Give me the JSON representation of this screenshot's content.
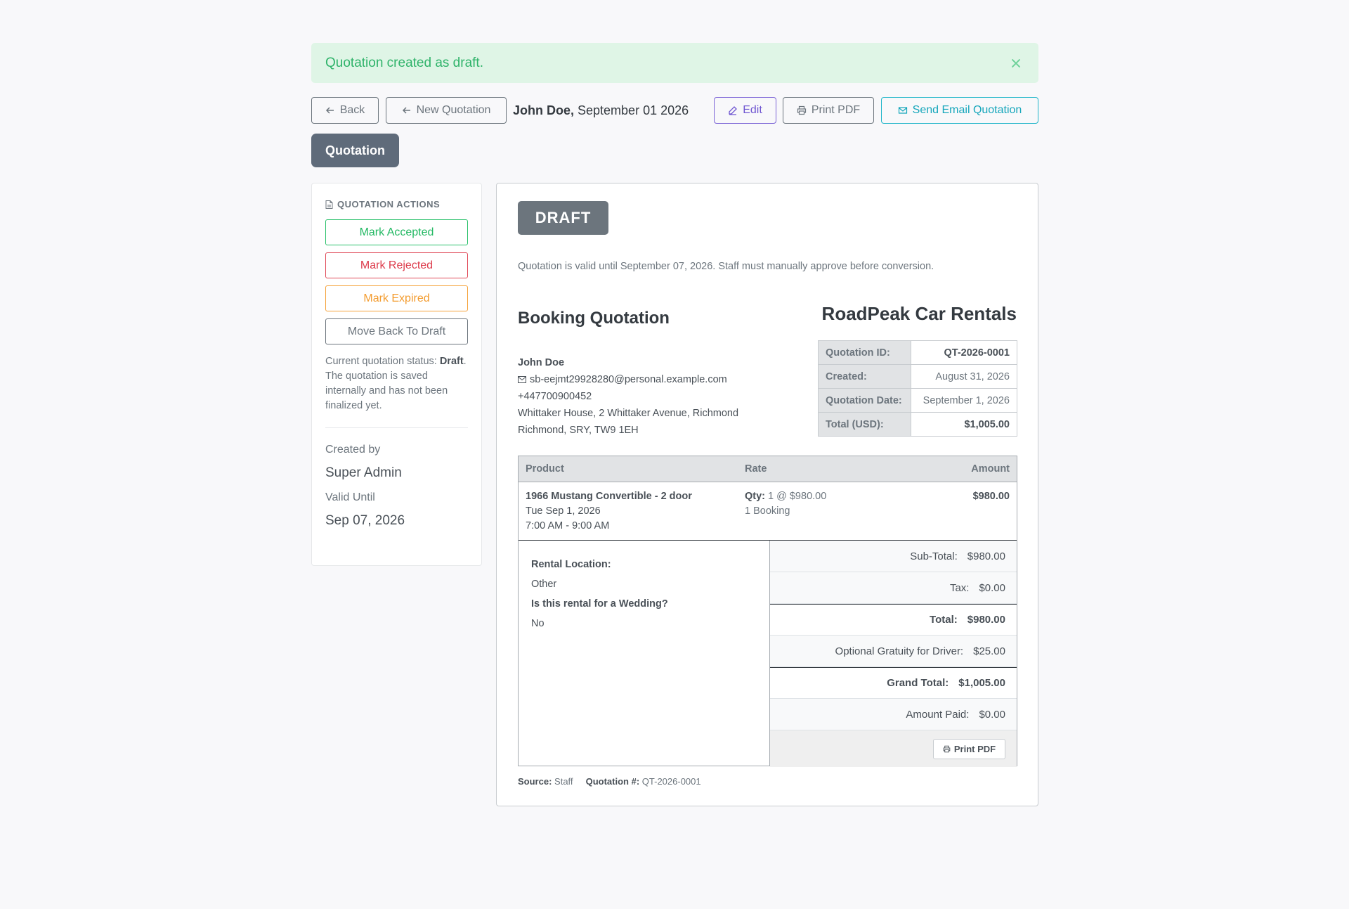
{
  "alert": {
    "message": "Quotation created as draft."
  },
  "toolbar": {
    "back_label": "Back",
    "new_label": "New Quotation",
    "customer_name": "John Doe,",
    "date": "September 01 2026",
    "edit_label": "Edit",
    "print_label": "Print PDF",
    "email_label": "Send Email Quotation"
  },
  "tab": {
    "label": "Quotation"
  },
  "sidebar": {
    "heading": "QUOTATION ACTIONS",
    "actions": [
      "Mark Accepted",
      "Mark Rejected",
      "Mark Expired",
      "Move Back To Draft"
    ],
    "status_prefix": "Current quotation status:",
    "status_value": "Draft",
    "status_suffix": ". The quotation is saved internally and has not been finalized yet.",
    "created_by_label": "Created by",
    "created_by_value": "Super Admin",
    "valid_until_label": "Valid Until",
    "valid_until_value": "Sep 07, 2026"
  },
  "quote": {
    "status_badge": "DRAFT",
    "validity_note": "Quotation is valid until September 07, 2026. Staff must manually approve before conversion.",
    "title": "Booking Quotation",
    "company": "RoadPeak Car Rentals",
    "info": {
      "id_label": "Quotation ID:",
      "id_value": "QT-2026-0001",
      "created_label": "Created:",
      "created_value": "August 31, 2026",
      "date_label": "Quotation Date:",
      "date_value": "September 1, 2026",
      "total_label": "Total (USD):",
      "total_value": "$1,005.00"
    },
    "customer": {
      "name": "John Doe",
      "email": "sb-eejmt29928280@personal.example.com",
      "phone": "+447700900452",
      "address1": "Whittaker House, 2 Whittaker Avenue, Richmond",
      "address2": "Richmond, SRY, TW9 1EH"
    },
    "products": {
      "headers": {
        "product": "Product",
        "rate": "Rate",
        "amount": "Amount"
      },
      "row": {
        "name": "1966 Mustang Convertible - 2 door",
        "date": "Tue Sep 1, 2026",
        "time": "7:00 AM - 9:00 AM",
        "qty_label": "Qty:",
        "qty_value": "1 @ $980.00",
        "booking": "1 Booking",
        "amount": "$980.00"
      }
    },
    "details": {
      "location_label": "Rental Location:",
      "location_value": "Other",
      "wedding_label": "Is this rental for a Wedding?",
      "wedding_value": "No"
    },
    "totals": {
      "subtotal_label": "Sub-Total:",
      "subtotal_value": "$980.00",
      "tax_label": "Tax:",
      "tax_value": "$0.00",
      "total_label": "Total:",
      "total_value": "$980.00",
      "gratuity_label": "Optional Gratuity for Driver:",
      "gratuity_value": "$25.00",
      "grand_label": "Grand Total:",
      "grand_value": "$1,005.00",
      "paid_label": "Amount Paid:",
      "paid_value": "$0.00",
      "print_label": "Print PDF"
    },
    "footer": {
      "source_label": "Source:",
      "source_value": "Staff",
      "number_label": "Quotation #:",
      "number_value": "QT-2026-0001"
    }
  }
}
